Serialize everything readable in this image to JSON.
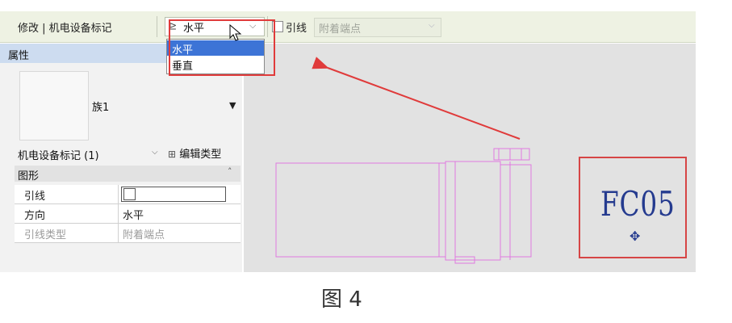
{
  "options_bar": {
    "modify_tab": "修改 | 机电设备标记",
    "direction_value": "水平",
    "leader_label": "引线",
    "leader_type_value": "附着端点"
  },
  "direction_dropdown": {
    "options": [
      "水平",
      "垂直"
    ],
    "selected": "水平"
  },
  "properties": {
    "title": "属性",
    "family_name": "族1",
    "type_filter": "机电设备标记 (1)",
    "edit_type_label": "编辑类型",
    "group_label": "图形",
    "rows": [
      {
        "label": "引线",
        "value": ""
      },
      {
        "label": "方向",
        "value": "水平"
      },
      {
        "label": "引线类型",
        "value": "附着端点"
      }
    ]
  },
  "canvas": {
    "tag_text": "FC05"
  },
  "caption": "图 4",
  "colors": {
    "highlight_red": "#e03b3b",
    "tag_blue": "#253b8f",
    "selection_blue": "#3d74d6",
    "equipment_magenta": "#e07ae0"
  },
  "icons": {
    "direction": "tag-direction-icon",
    "cursor": "mouse-pointer-icon",
    "move": "move-icon",
    "edit_type": "edit-type-icon"
  }
}
